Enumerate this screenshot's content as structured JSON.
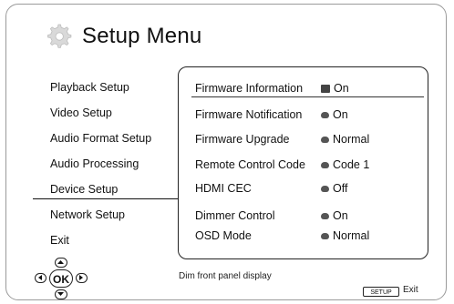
{
  "header": {
    "title": "Setup Menu",
    "icon": "gear-icon"
  },
  "menu": {
    "items": [
      "Playback Setup",
      "Video Setup",
      "Audio Format Setup",
      "Audio Processing",
      "Device Setup",
      "Network Setup",
      "Exit"
    ],
    "active_index": 4
  },
  "panel": {
    "rows": [
      {
        "label": "Firmware Information",
        "value": "On",
        "icon": "square-icon"
      },
      {
        "label": "Firmware Notification",
        "value": "On",
        "icon": "knob-icon"
      },
      {
        "label": "Firmware Upgrade",
        "value": "Normal",
        "icon": "knob-icon"
      },
      {
        "label": "Remote Control Code",
        "value": "Code 1",
        "icon": "knob-icon"
      },
      {
        "label": "HDMI CEC",
        "value": "Off",
        "icon": "knob-icon"
      },
      {
        "label": "Dimmer Control",
        "value": "On",
        "icon": "knob-icon"
      },
      {
        "label": "OSD Mode",
        "value": "Normal",
        "icon": "knob-icon"
      }
    ],
    "highlighted_index": 0
  },
  "footer": {
    "hint": "Dim front panel display",
    "ok_label": "OK",
    "setup_label": "SETUP",
    "exit_label": "Exit"
  },
  "colors": {
    "text": "#111111",
    "border": "#222222",
    "frame": "#9a9a9a"
  }
}
